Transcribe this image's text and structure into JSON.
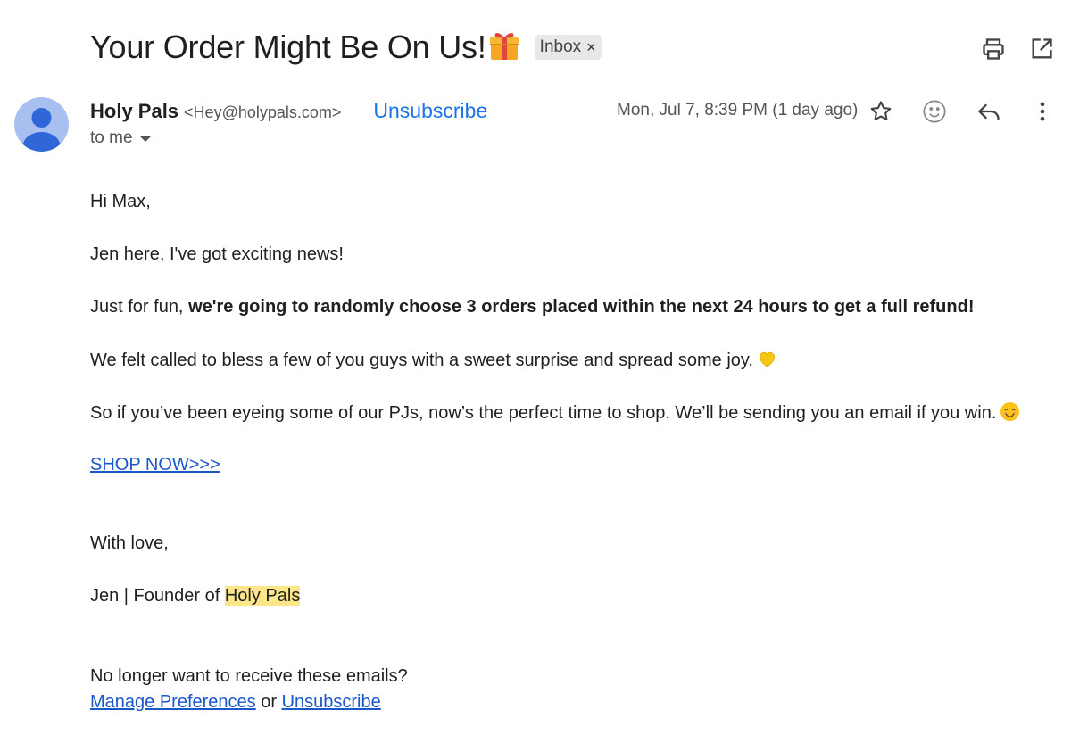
{
  "subject": "Your Order Might Be On Us!",
  "label_chip": {
    "text": "Inbox",
    "remove": "×"
  },
  "sender": {
    "name": "Holy Pals",
    "email": "<Hey@holypals.com>",
    "unsubscribe": "Unsubscribe",
    "date": "Mon, Jul 7, 8:39 PM (1 day ago)",
    "recipient": "to me"
  },
  "body": {
    "greeting": "Hi Max,",
    "line1": "Jen here, I've got exciting news!",
    "line2_prefix": "Just for fun, ",
    "line2_bold": "we're going to randomly choose 3 orders placed within the next 24 hours to get a full refund!",
    "line3": "We felt called to bless a few of you guys with a sweet surprise and spread some joy.",
    "line4": "So if you’ve been eyeing some of our PJs, now’s the perfect time to shop. We’ll be sending you an email if you win.",
    "shop_link": "SHOP NOW>>>",
    "closing": "With love,",
    "signature_prefix": "Jen | Founder of ",
    "signature_highlight": "Holy Pals",
    "footer_question": "No longer want to receive these emails?",
    "manage_link": "Manage Preferences",
    "or_text": " or ",
    "unsubscribe_link": "Unsubscribe"
  },
  "icons": {
    "subject_emoji": "gift-icon",
    "print": "print-icon",
    "open_new_window": "open-in-new-icon",
    "star": "star-icon",
    "emoji_reaction": "smiley-icon",
    "reply": "reply-icon",
    "more": "more-vert-icon",
    "heart": "yellow-heart-icon",
    "smile": "smiling-face-icon"
  },
  "colors": {
    "link_blue": "#1a57c7",
    "unsubscribe_blue": "#1a73e8",
    "highlight": "#fde68a",
    "avatar_bg": "#a8c0f0"
  }
}
